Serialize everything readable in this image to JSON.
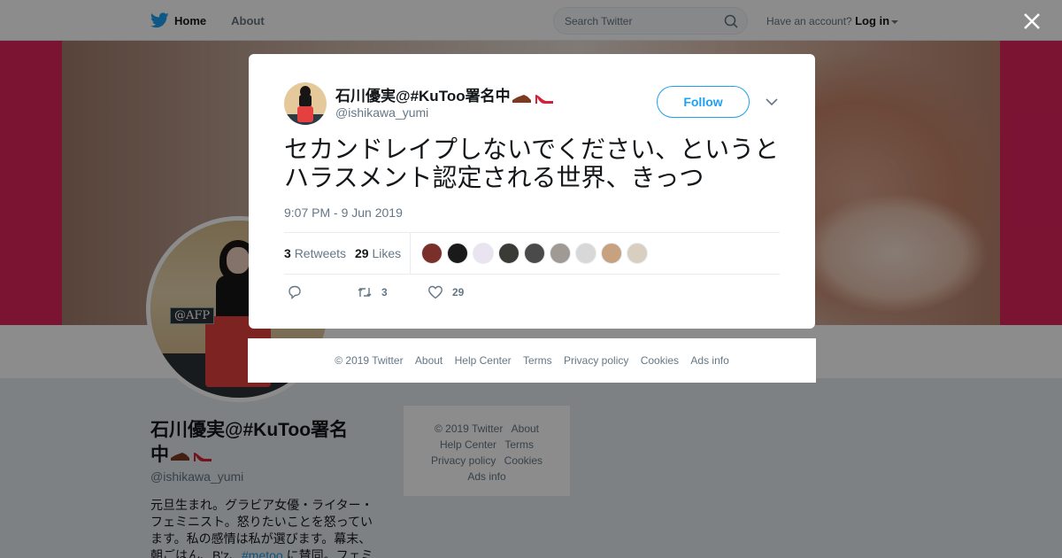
{
  "topbar": {
    "home_label": "Home",
    "about_label": "About",
    "search_placeholder": "Search Twitter",
    "account_prompt": "Have an account?",
    "login_label": "Log in"
  },
  "profile": {
    "name": "石川優実@#KuToo署名中",
    "handle": "@ishikawa_yumi",
    "bio_before": "元旦生まれ。グラビア女優・ライター・フェミニスト。怒りたいことを怒っています。私の感情は私が選びます。幕末、朝ごはん、B'z、",
    "bio_link": "#metoo",
    "bio_after": " に賛同。フェミ",
    "avatar_watermark": "@AFP"
  },
  "side_footer": {
    "links": [
      "© 2019 Twitter",
      "About",
      "Help Center",
      "Terms",
      "Privacy policy",
      "Cookies",
      "Ads info"
    ]
  },
  "tweet": {
    "author_name": "石川優実@#KuToo署名中",
    "author_handle": "@ishikawa_yumi",
    "follow_label": "Follow",
    "text": "セカンドレイプしないでください、というとハラスメント認定される世界、きっつ",
    "timestamp": "9:07 PM - 9 Jun 2019",
    "retweets_count": "3",
    "retweets_label": "Retweets",
    "likes_count": "29",
    "likes_label": "Likes",
    "action_retweet_count": "3",
    "action_like_count": "29",
    "liker_colors": [
      "#7a2f2a",
      "#1a1a1a",
      "#e9e4ef",
      "#3b3a36",
      "#4a4a4a",
      "#a09a95",
      "#d8d8d8",
      "#c7a180",
      "#d9cfc1"
    ]
  },
  "modal_footer": {
    "links": [
      "© 2019 Twitter",
      "About",
      "Help Center",
      "Terms",
      "Privacy policy",
      "Cookies",
      "Ads info"
    ]
  },
  "colors": {
    "accent": "#1da1f2",
    "banner": "#e0245e",
    "muted_text": "#657786"
  }
}
